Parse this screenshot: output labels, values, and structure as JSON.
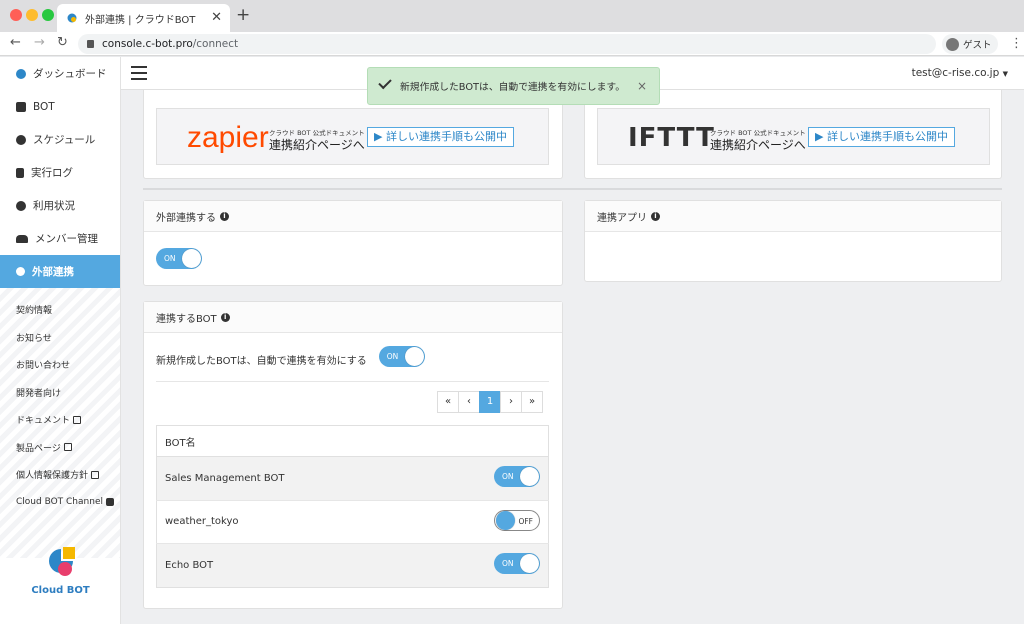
{
  "browser": {
    "tab_title": "外部連携 | クラウドBOT",
    "url_host": "console.c-bot.pro",
    "url_path": "/connect",
    "profile_label": "ゲスト"
  },
  "sidebar": {
    "items": [
      {
        "label": "ダッシュボード",
        "icon": "logo-icon"
      },
      {
        "label": "BOT",
        "icon": "robot-icon"
      },
      {
        "label": "スケジュール",
        "icon": "clock-icon"
      },
      {
        "label": "実行ログ",
        "icon": "file-icon"
      },
      {
        "label": "利用状況",
        "icon": "pie-chart-icon"
      },
      {
        "label": "メンバー管理",
        "icon": "users-icon"
      },
      {
        "label": "外部連携",
        "icon": "link-icon",
        "active": true
      }
    ],
    "sub_items": [
      "契約情報",
      "お知らせ",
      "お問い合わせ",
      "開発者向け",
      "ドキュメント",
      "製品ページ",
      "個人情報保護方針",
      "Cloud BOT Channel"
    ],
    "logo_text": "Cloud BOT"
  },
  "header": {
    "user_email": "test@c-rise.co.jp"
  },
  "toast": {
    "message": "新規作成したBOTは、自動で連携を有効にします。",
    "close": "×"
  },
  "banners": [
    {
      "brand": "zapier",
      "doc_small": "クラウド BOT 公式ドキュメント",
      "doc_big": "連携紹介ページへ",
      "button": "▶ 詳しい連携手順も公開中",
      "brand_color": "#ff4a00"
    },
    {
      "brand": "IFTTT",
      "doc_small": "クラウド BOT 公式ドキュメント",
      "doc_big": "連携紹介ページへ",
      "button": "▶ 詳しい連携手順も公開中",
      "brand_color": "#000000"
    }
  ],
  "external": {
    "title": "外部連携する",
    "toggle": "ON"
  },
  "apps": {
    "title": "連携アプリ"
  },
  "bots": {
    "title": "連携するBOT",
    "auto_label": "新規作成したBOTは、自動で連携を有効にする",
    "auto_toggle": "ON",
    "pager": [
      "«",
      "‹",
      "1",
      "›",
      "»"
    ],
    "column": "BOT名",
    "rows": [
      {
        "name": "Sales Management BOT",
        "state": "ON"
      },
      {
        "name": "weather_tokyo",
        "state": "OFF"
      },
      {
        "name": "Echo BOT",
        "state": "ON"
      }
    ]
  },
  "colors": {
    "accent": "#54a8e0",
    "toast_bg": "#cfead0"
  }
}
